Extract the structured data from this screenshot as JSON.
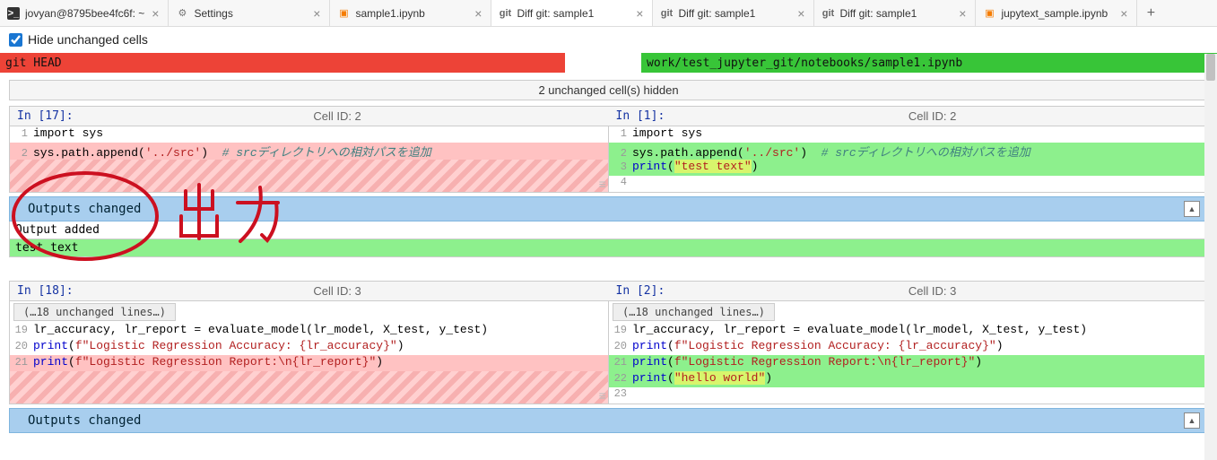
{
  "tabs": [
    {
      "icon": "terminal",
      "label": "jovyan@8795bee4fc6f: ~",
      "closeChar": "×"
    },
    {
      "icon": "gear",
      "label": "Settings",
      "closeChar": "×"
    },
    {
      "icon": "notebook",
      "label": "sample1.ipynb",
      "closeChar": "×"
    },
    {
      "icon": "git",
      "label": "Diff git: sample1",
      "closeChar": "×",
      "active": true
    },
    {
      "icon": "git",
      "label": "Diff git: sample1",
      "closeChar": "×"
    },
    {
      "icon": "git",
      "label": "Diff git: sample1",
      "closeChar": "×"
    },
    {
      "icon": "notebook",
      "label": "jupytext_sample.ipynb",
      "closeChar": "×"
    }
  ],
  "toolbar": {
    "hideUnchanged": "Hide unchanged cells",
    "checked": true
  },
  "sources": {
    "left": "git HEAD",
    "right": "work/test_jupyter_git/notebooks/sample1.ipynb"
  },
  "hiddenBanner": "2 unchanged cell(s) hidden",
  "chunk1": {
    "left": {
      "prompt": "In [17]:",
      "cellId": "Cell ID: 2",
      "lines": [
        {
          "n": "1",
          "plain": "import sys",
          "cls": ""
        },
        {
          "n": "2",
          "html": "sys.path.append(<span class='str'>'../src'</span>)  <span class='cmt'># srcディレクトリへの相対パスを追加</span>",
          "cls": "line-del"
        }
      ]
    },
    "right": {
      "prompt": "In [1]:",
      "cellId": "Cell ID: 2",
      "lines": [
        {
          "n": "1",
          "plain": "import sys",
          "cls": ""
        },
        {
          "n": "2",
          "html": "sys.path.append(<span class='str'>'../src'</span>)  <span class='cmt'># srcディレクトリへの相対パスを追加</span>",
          "cls": "line-add"
        },
        {
          "n": "3",
          "html": "<span class='fn'>print</span>(<span class='str hl-str'>\"test text\"</span>)",
          "cls": "line-add"
        },
        {
          "n": "4",
          "plain": "",
          "cls": ""
        }
      ]
    }
  },
  "outputs1": {
    "banner": "Outputs changed",
    "addedLabel": "Output added",
    "addedText": "test text"
  },
  "chunk2": {
    "left": {
      "prompt": "In [18]:",
      "cellId": "Cell ID: 3",
      "unchanged": "(…18 unchanged lines…)",
      "lines": [
        {
          "n": "19",
          "plain": "lr_accuracy, lr_report = evaluate_model(lr_model, X_test, y_test)",
          "cls": ""
        },
        {
          "n": "20",
          "html": "<span class='fn'>print</span>(<span class='str'>f\"Logistic Regression Accuracy: {lr_accuracy}\"</span>)",
          "cls": ""
        },
        {
          "n": "21",
          "html": "<span class='fn'>print</span>(<span class='str'>f\"Logistic Regression Report:\\n{lr_report}\"</span>)",
          "cls": "line-del"
        }
      ]
    },
    "right": {
      "prompt": "In [2]:",
      "cellId": "Cell ID: 3",
      "unchanged": "(…18 unchanged lines…)",
      "lines": [
        {
          "n": "19",
          "plain": "lr_accuracy, lr_report = evaluate_model(lr_model, X_test, y_test)",
          "cls": ""
        },
        {
          "n": "20",
          "html": "<span class='fn'>print</span>(<span class='str'>f\"Logistic Regression Accuracy: {lr_accuracy}\"</span>)",
          "cls": ""
        },
        {
          "n": "21",
          "html": "<span class='fn'>print</span>(<span class='str'>f\"Logistic Regression Report:\\n{lr_report}\"</span>)",
          "cls": "line-add"
        },
        {
          "n": "22",
          "html": "<span class='fn'>print</span>(<span class='str hl-str'>\"hello world\"</span>)",
          "cls": "line-add"
        },
        {
          "n": "23",
          "plain": "",
          "cls": ""
        }
      ]
    }
  },
  "outputs2": {
    "banner": "Outputs changed"
  },
  "handwriting": "出力"
}
